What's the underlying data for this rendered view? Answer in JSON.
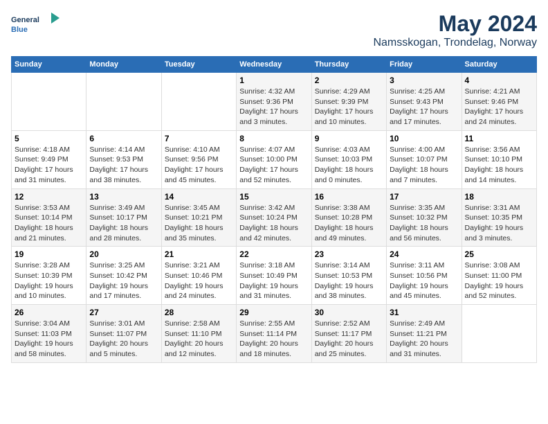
{
  "logo": {
    "text_line1": "General",
    "text_line2": "Blue"
  },
  "title": "May 2024",
  "subtitle": "Namsskogan, Trondelag, Norway",
  "days_of_week": [
    "Sunday",
    "Monday",
    "Tuesday",
    "Wednesday",
    "Thursday",
    "Friday",
    "Saturday"
  ],
  "weeks": [
    [
      {
        "day": "",
        "info": ""
      },
      {
        "day": "",
        "info": ""
      },
      {
        "day": "",
        "info": ""
      },
      {
        "day": "1",
        "info": "Sunrise: 4:32 AM\nSunset: 9:36 PM\nDaylight: 17 hours\nand 3 minutes."
      },
      {
        "day": "2",
        "info": "Sunrise: 4:29 AM\nSunset: 9:39 PM\nDaylight: 17 hours\nand 10 minutes."
      },
      {
        "day": "3",
        "info": "Sunrise: 4:25 AM\nSunset: 9:43 PM\nDaylight: 17 hours\nand 17 minutes."
      },
      {
        "day": "4",
        "info": "Sunrise: 4:21 AM\nSunset: 9:46 PM\nDaylight: 17 hours\nand 24 minutes."
      }
    ],
    [
      {
        "day": "5",
        "info": "Sunrise: 4:18 AM\nSunset: 9:49 PM\nDaylight: 17 hours\nand 31 minutes."
      },
      {
        "day": "6",
        "info": "Sunrise: 4:14 AM\nSunset: 9:53 PM\nDaylight: 17 hours\nand 38 minutes."
      },
      {
        "day": "7",
        "info": "Sunrise: 4:10 AM\nSunset: 9:56 PM\nDaylight: 17 hours\nand 45 minutes."
      },
      {
        "day": "8",
        "info": "Sunrise: 4:07 AM\nSunset: 10:00 PM\nDaylight: 17 hours\nand 52 minutes."
      },
      {
        "day": "9",
        "info": "Sunrise: 4:03 AM\nSunset: 10:03 PM\nDaylight: 18 hours\nand 0 minutes."
      },
      {
        "day": "10",
        "info": "Sunrise: 4:00 AM\nSunset: 10:07 PM\nDaylight: 18 hours\nand 7 minutes."
      },
      {
        "day": "11",
        "info": "Sunrise: 3:56 AM\nSunset: 10:10 PM\nDaylight: 18 hours\nand 14 minutes."
      }
    ],
    [
      {
        "day": "12",
        "info": "Sunrise: 3:53 AM\nSunset: 10:14 PM\nDaylight: 18 hours\nand 21 minutes."
      },
      {
        "day": "13",
        "info": "Sunrise: 3:49 AM\nSunset: 10:17 PM\nDaylight: 18 hours\nand 28 minutes."
      },
      {
        "day": "14",
        "info": "Sunrise: 3:45 AM\nSunset: 10:21 PM\nDaylight: 18 hours\nand 35 minutes."
      },
      {
        "day": "15",
        "info": "Sunrise: 3:42 AM\nSunset: 10:24 PM\nDaylight: 18 hours\nand 42 minutes."
      },
      {
        "day": "16",
        "info": "Sunrise: 3:38 AM\nSunset: 10:28 PM\nDaylight: 18 hours\nand 49 minutes."
      },
      {
        "day": "17",
        "info": "Sunrise: 3:35 AM\nSunset: 10:32 PM\nDaylight: 18 hours\nand 56 minutes."
      },
      {
        "day": "18",
        "info": "Sunrise: 3:31 AM\nSunset: 10:35 PM\nDaylight: 19 hours\nand 3 minutes."
      }
    ],
    [
      {
        "day": "19",
        "info": "Sunrise: 3:28 AM\nSunset: 10:39 PM\nDaylight: 19 hours\nand 10 minutes."
      },
      {
        "day": "20",
        "info": "Sunrise: 3:25 AM\nSunset: 10:42 PM\nDaylight: 19 hours\nand 17 minutes."
      },
      {
        "day": "21",
        "info": "Sunrise: 3:21 AM\nSunset: 10:46 PM\nDaylight: 19 hours\nand 24 minutes."
      },
      {
        "day": "22",
        "info": "Sunrise: 3:18 AM\nSunset: 10:49 PM\nDaylight: 19 hours\nand 31 minutes."
      },
      {
        "day": "23",
        "info": "Sunrise: 3:14 AM\nSunset: 10:53 PM\nDaylight: 19 hours\nand 38 minutes."
      },
      {
        "day": "24",
        "info": "Sunrise: 3:11 AM\nSunset: 10:56 PM\nDaylight: 19 hours\nand 45 minutes."
      },
      {
        "day": "25",
        "info": "Sunrise: 3:08 AM\nSunset: 11:00 PM\nDaylight: 19 hours\nand 52 minutes."
      }
    ],
    [
      {
        "day": "26",
        "info": "Sunrise: 3:04 AM\nSunset: 11:03 PM\nDaylight: 19 hours\nand 58 minutes."
      },
      {
        "day": "27",
        "info": "Sunrise: 3:01 AM\nSunset: 11:07 PM\nDaylight: 20 hours\nand 5 minutes."
      },
      {
        "day": "28",
        "info": "Sunrise: 2:58 AM\nSunset: 11:10 PM\nDaylight: 20 hours\nand 12 minutes."
      },
      {
        "day": "29",
        "info": "Sunrise: 2:55 AM\nSunset: 11:14 PM\nDaylight: 20 hours\nand 18 minutes."
      },
      {
        "day": "30",
        "info": "Sunrise: 2:52 AM\nSunset: 11:17 PM\nDaylight: 20 hours\nand 25 minutes."
      },
      {
        "day": "31",
        "info": "Sunrise: 2:49 AM\nSunset: 11:21 PM\nDaylight: 20 hours\nand 31 minutes."
      },
      {
        "day": "",
        "info": ""
      }
    ]
  ]
}
